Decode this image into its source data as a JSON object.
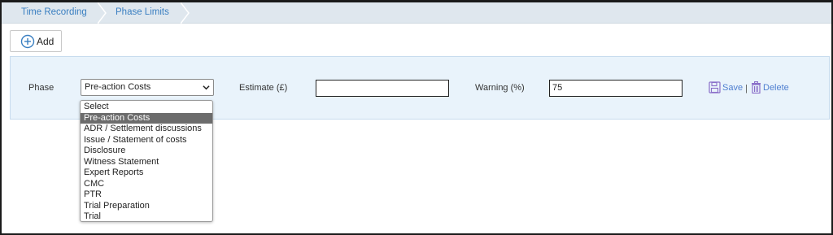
{
  "breadcrumb": {
    "items": [
      "Time Recording",
      "Phase Limits"
    ]
  },
  "toolbar": {
    "add_label": "Add"
  },
  "form": {
    "phase_label": "Phase",
    "phase_value": "Pre-action Costs",
    "estimate_label": "Estimate (£)",
    "estimate_value": "",
    "warning_label": "Warning (%)",
    "warning_value": "75",
    "save_label": "Save",
    "separator": "|",
    "delete_label": "Delete"
  },
  "phase_options": [
    "Select",
    "Pre-action Costs",
    "ADR / Settlement discussions",
    "Issue / Statement of costs",
    "Disclosure",
    "Witness Statement",
    "Expert Reports",
    "CMC",
    "PTR",
    "Trial Preparation",
    "Trial"
  ],
  "selected_option_index": 1,
  "colors": {
    "link_blue": "#3a7fc1",
    "action_blue": "#4f7fd0",
    "icon_purple": "#8a6fc9",
    "panel_bg": "#e9f3fb",
    "selected_bg": "#6c6c6c"
  }
}
